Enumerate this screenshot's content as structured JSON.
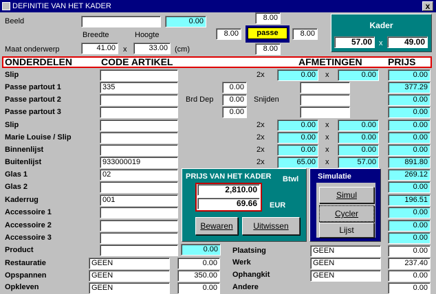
{
  "window": {
    "title": "DEFINITIE VAN HET KADER",
    "close": "x"
  },
  "top": {
    "beeld_label": "Beeld",
    "beeld_value": "",
    "beeld_price": "0.00",
    "breedte_label": "Breedte",
    "hoogte_label": "Hoogte",
    "maat_label": "Maat onderwerp",
    "breedte_value": "41.00",
    "times": "x",
    "hoogte_value": "33.00",
    "unit": "(cm)",
    "passe_top": "8.00",
    "passe_left": "8.00",
    "passe_right": "8.00",
    "passe_bottom": "8.00",
    "passe_label": "passe"
  },
  "kader": {
    "title": "Kader",
    "width": "57.00",
    "times": "x",
    "height": "49.00"
  },
  "header": {
    "onderdelen": "ONDERDELEN",
    "code": "CODE ARTIKEL",
    "afmetingen": "AFMETINGEN",
    "prijs": "PRIJS"
  },
  "rows": [
    {
      "label": "Slip",
      "code": "",
      "mult": "2x",
      "w": "0.00",
      "x": "x",
      "h": "0.00",
      "price": "0.00"
    },
    {
      "label": "Passe partout 1",
      "code": "335",
      "price": "377.29"
    },
    {
      "label": "Passe partout 2",
      "code": "",
      "price": "0.00"
    },
    {
      "label": "Passe partout 3",
      "code": "",
      "price": "0.00"
    },
    {
      "label": "Slip",
      "code": "",
      "mult": "2x",
      "w": "0.00",
      "x": "x",
      "h": "0.00",
      "price": "0.00"
    },
    {
      "label": "Marie Louise / Slip",
      "code": "",
      "mult": "2x",
      "w": "0.00",
      "x": "x",
      "h": "0.00",
      "price": "0.00"
    },
    {
      "label": "Binnenlijst",
      "code": "",
      "mult": "2x",
      "w": "0.00",
      "x": "x",
      "h": "0.00",
      "price": "0.00"
    },
    {
      "label": "Buitenlijst",
      "code": "933000019",
      "mult": "2x",
      "w": "65.00",
      "x": "x",
      "h": "57.00",
      "price": "891.80"
    },
    {
      "label": "Glas 1",
      "code": "02",
      "price": "269.12"
    },
    {
      "label": "Glas 2",
      "code": "",
      "price": "0.00"
    },
    {
      "label": "Kaderrug",
      "code": "001",
      "price": "196.51"
    },
    {
      "label": "Accessoire 1",
      "code": "",
      "price": "0.00"
    },
    {
      "label": "Accessoire 2",
      "code": "",
      "price": "0.00"
    },
    {
      "label": "Accessoire 3",
      "code": "",
      "price": "0.00"
    },
    {
      "label": "Product",
      "code": "",
      "product_price": "0.00"
    }
  ],
  "brd": {
    "brd_dep_label": "Brd Dep",
    "snijden_label": "Snijden",
    "v1": "0.00",
    "v2": "0.00",
    "v3": "0.00",
    "s1": "",
    "s2": "",
    "s3": ""
  },
  "prijs_panel": {
    "title": "PRIJS VAN HET KADER",
    "btwl": "Btwl",
    "total": "2,810.00",
    "eur_value": "69.66",
    "currency": "EUR",
    "bewaren": "Bewaren",
    "uitwissen": "Uitwissen"
  },
  "simulatie": {
    "title": "Simulatie",
    "simul": "Simul",
    "cycler": "Cycler",
    "lijst": "Lijst"
  },
  "bottom_left": [
    {
      "label": "Restauratie",
      "value": "GEEN",
      "price": "0.00"
    },
    {
      "label": "Opspannen",
      "value": "GEEN",
      "price": "350.00"
    },
    {
      "label": "Opkleven",
      "value": "GEEN",
      "price": "0.00"
    }
  ],
  "bottom_right": [
    {
      "label": "Plaatsing",
      "value": "GEEN",
      "price": "0.00"
    },
    {
      "label": "Werk",
      "value": "GEEN",
      "price": "237.40"
    },
    {
      "label": "Ophangkit",
      "value": "GEEN",
      "price": "0.00"
    },
    {
      "label": "Andere",
      "value": "",
      "price": "0.00"
    }
  ]
}
